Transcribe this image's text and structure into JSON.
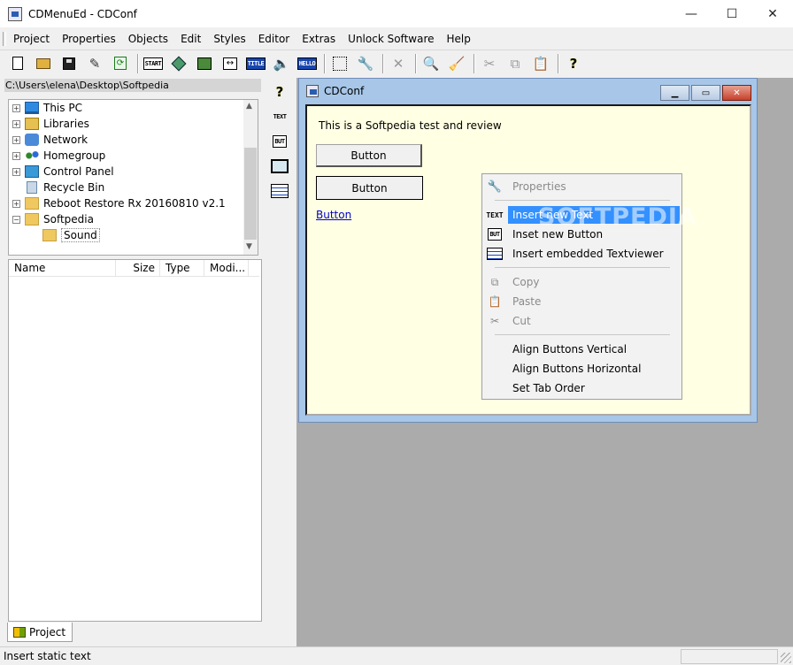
{
  "window": {
    "title": "CDMenuEd - CDConf",
    "minimize_glyph": "—",
    "maximize_glyph": "☐",
    "close_glyph": "✕"
  },
  "menu": [
    "Project",
    "Properties",
    "Objects",
    "Edit",
    "Styles",
    "Editor",
    "Extras",
    "Unlock Software",
    "Help"
  ],
  "toolbar": {
    "start_label": "START",
    "title_label": "TITLE",
    "hello_label": "HELLO"
  },
  "left_panel": {
    "path": "C:\\Users\\elena\\Desktop\\Softpedia",
    "tree": [
      {
        "label": "This PC",
        "icon": "pc-icon",
        "expander": "+"
      },
      {
        "label": "Libraries",
        "icon": "libraries-icon",
        "expander": "+"
      },
      {
        "label": "Network",
        "icon": "network-icon",
        "expander": "+"
      },
      {
        "label": "Homegroup",
        "icon": "homegroup-icon",
        "expander": "+"
      },
      {
        "label": "Control Panel",
        "icon": "control-panel-icon",
        "expander": "+"
      },
      {
        "label": "Recycle Bin",
        "icon": "recycle-bin-icon",
        "expander": ""
      },
      {
        "label": "Reboot Restore Rx 20160810 v2.1",
        "icon": "folder-icon",
        "expander": "+"
      },
      {
        "label": "Softpedia",
        "icon": "folder-icon",
        "expander": "−"
      },
      {
        "label": "Sound",
        "icon": "folder-icon",
        "expander": ""
      }
    ],
    "columns": [
      "Name",
      "Size",
      "Type",
      "Modi..."
    ],
    "tab_label": "Project"
  },
  "side_toolbar": {
    "text_label": "TEXT",
    "but_label": "BUT"
  },
  "child_window": {
    "title": "CDConf",
    "label_text": "This is a Softpedia test and review",
    "button1": "Button",
    "button2": "Button",
    "link": "Button"
  },
  "context_menu": {
    "items": [
      {
        "label": "Properties",
        "state": "disabled"
      },
      {
        "label": "Insert new Text",
        "state": "highlighted",
        "icon_text": "TEXT"
      },
      {
        "label": "Inset new Button",
        "state": "normal",
        "icon_text": "BUT"
      },
      {
        "label": "Insert embedded Textviewer",
        "state": "normal"
      },
      {
        "label": "Copy",
        "state": "disabled"
      },
      {
        "label": "Paste",
        "state": "disabled"
      },
      {
        "label": "Cut",
        "state": "disabled"
      },
      {
        "label": "Align Buttons Vertical",
        "state": "normal"
      },
      {
        "label": "Align Buttons Horizontal",
        "state": "normal"
      },
      {
        "label": "Set Tab Order",
        "state": "normal"
      }
    ],
    "watermark": "SOFTPEDIA"
  },
  "status": {
    "text": "Insert static text"
  }
}
